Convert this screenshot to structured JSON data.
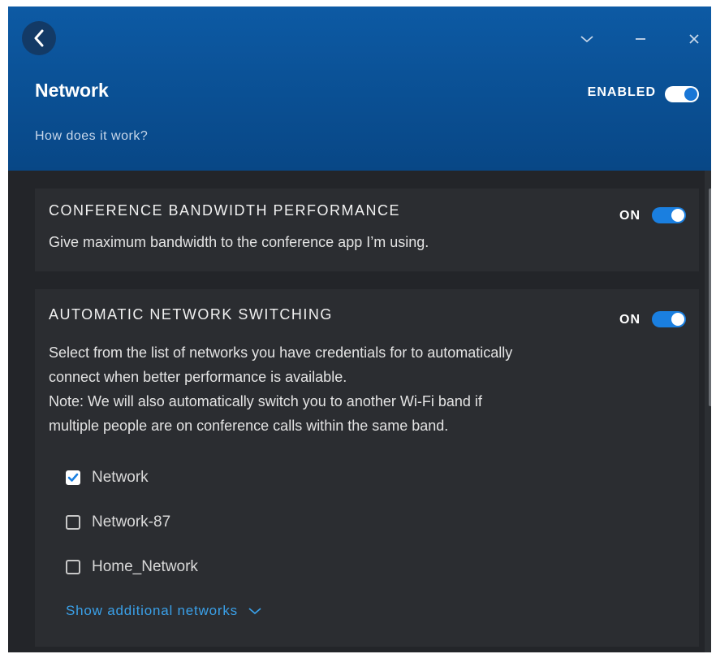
{
  "header": {
    "title": "Network",
    "enabled_label": "ENABLED",
    "enabled": true,
    "help_link": "How does it work?"
  },
  "window_controls": {
    "back_icon": "chevron-left-icon",
    "collapse_icon": "chevron-down-icon",
    "minimize_icon": "minimize-icon",
    "close_icon": "close-icon"
  },
  "conference": {
    "title": "CONFERENCE BANDWIDTH PERFORMANCE",
    "status_label": "ON",
    "enabled": true,
    "description": "Give maximum bandwidth to the conference app I’m using."
  },
  "switching": {
    "title": "AUTOMATIC NETWORK SWITCHING",
    "status_label": "ON",
    "enabled": true,
    "description_lines": [
      "Select from the list of networks you have credentials for to automatically",
      "connect when better performance is available.",
      "Note: We will also automatically switch you to another Wi-Fi band if",
      "multiple people are on conference calls within the same band."
    ],
    "networks": [
      {
        "name": "Network",
        "checked": true
      },
      {
        "name": "Network-87",
        "checked": false
      },
      {
        "name": "Home_Network",
        "checked": false
      }
    ],
    "show_more_label": "Show additional networks"
  },
  "colors": {
    "header_bg": "#0b4f96",
    "panel_bg": "#232529",
    "card_bg": "#2b2d31",
    "toggle_blue": "#1a7fe0",
    "link_blue": "#3aa0e8"
  }
}
